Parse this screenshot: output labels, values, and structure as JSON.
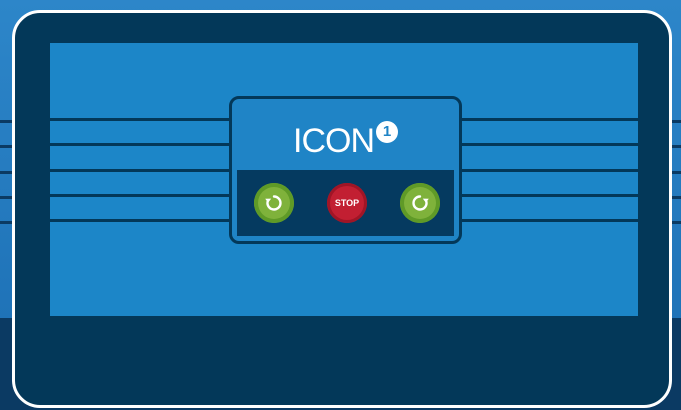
{
  "brand": {
    "name": "ICON",
    "badge": "1"
  },
  "controls": {
    "reverse_icon": "rotate-counterclockwise-icon",
    "stop_label": "STOP",
    "forward_icon": "rotate-clockwise-icon"
  },
  "colors": {
    "screen_blue": "#1c86c8",
    "frame_navy": "#033859",
    "frame_border": "#ffffff",
    "button_green": "#7fb23b",
    "button_red": "#c21f32"
  }
}
